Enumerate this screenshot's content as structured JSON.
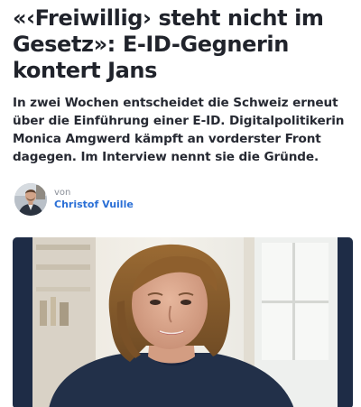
{
  "article": {
    "headline": "«‹Freiwillig› steht nicht im Gesetz»: E-ID-Gegnerin kontert Jans",
    "lead": "In zwei Wochen entscheidet die Schweiz erneut über die Einführung einer E-ID. Digitalpolitikerin Monica Amgwerd kämpft an vorderster Front dagegen. Im Interview nennt sie die Gründe.",
    "byline": {
      "prefix": "von",
      "author": "Christof Vuille",
      "avatar_icon": "person-photo-icon"
    },
    "hero_image": {
      "subject": "woman-portrait-photo",
      "accent_color": "#1b2a44"
    }
  },
  "colors": {
    "headline": "#20232b",
    "author_link": "#2a6fd6",
    "muted": "#8a8f98"
  }
}
